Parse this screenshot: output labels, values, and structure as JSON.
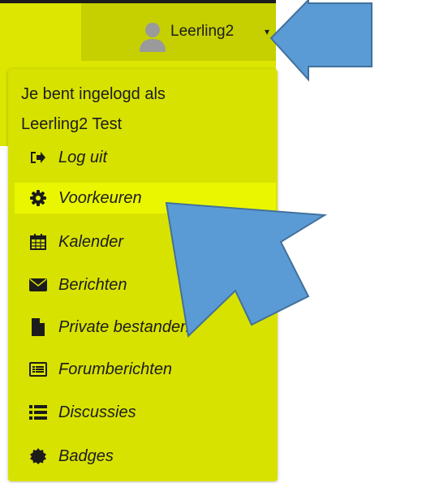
{
  "user_menu": {
    "username": "Leerling2",
    "caret_glyph": "▾"
  },
  "dropdown": {
    "header_line1": "Je bent ingelogd als",
    "header_line2": "Leerling2 Test",
    "items": [
      {
        "label": "Log uit",
        "icon": "logout-icon"
      },
      {
        "label": "Voorkeuren",
        "icon": "gear-icon",
        "active": true
      },
      {
        "label": "Kalender",
        "icon": "calendar-icon"
      },
      {
        "label": "Berichten",
        "icon": "envelope-icon"
      },
      {
        "label": "Private bestanden",
        "icon": "file-icon"
      },
      {
        "label": "Forumberichten",
        "icon": "list-alt-icon"
      },
      {
        "label": "Discussies",
        "icon": "list-icon"
      },
      {
        "label": "Badges",
        "icon": "badge-icon"
      }
    ]
  },
  "colors": {
    "navbar": "#dce600",
    "toggle": "#c6cf00",
    "menu": "#d8e200",
    "active_item": "#eaf600",
    "arrow": "#5b9bd5",
    "arrow_stroke": "#41719c"
  }
}
